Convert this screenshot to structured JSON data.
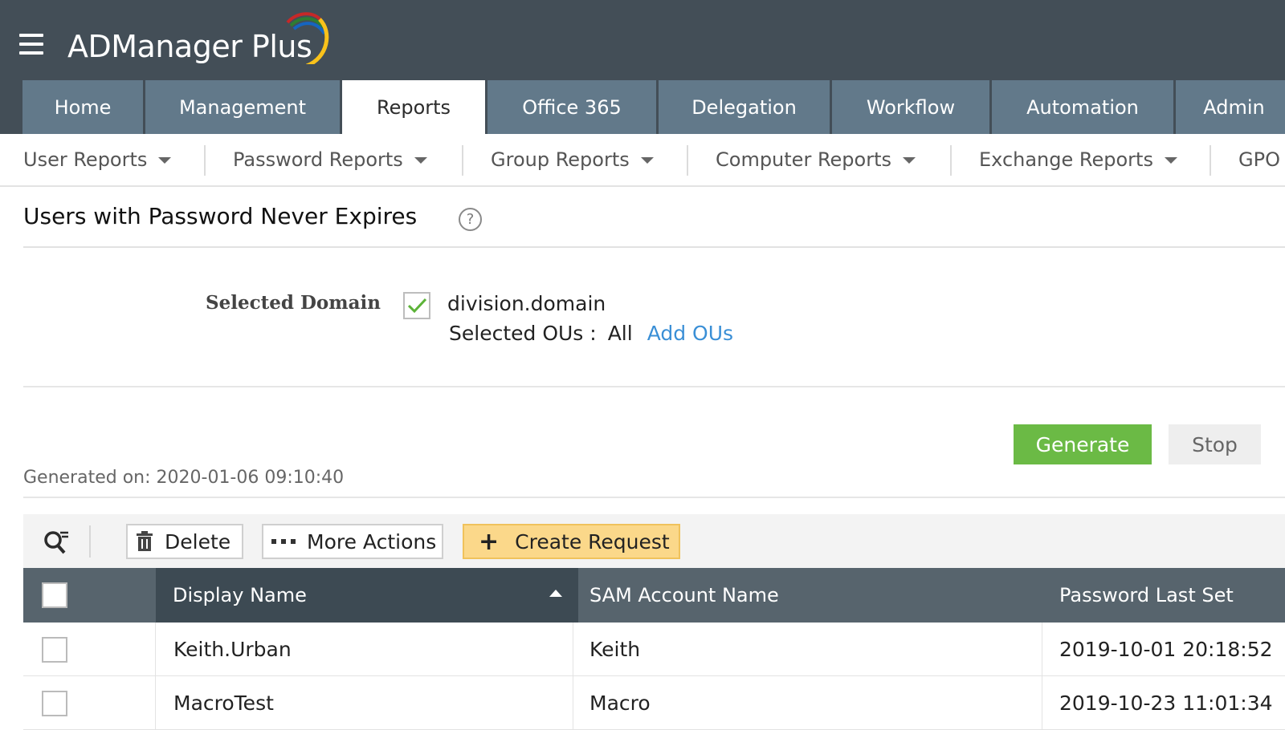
{
  "header": {
    "app_name": "ADManager Plus",
    "icons": {
      "menu": "hamburger-icon",
      "logo": "swoosh-logo"
    }
  },
  "main_nav": {
    "tabs": [
      {
        "label": "Home",
        "active": false
      },
      {
        "label": "Management",
        "active": false
      },
      {
        "label": "Reports",
        "active": true
      },
      {
        "label": "Office 365",
        "active": false
      },
      {
        "label": "Delegation",
        "active": false
      },
      {
        "label": "Workflow",
        "active": false
      },
      {
        "label": "Automation",
        "active": false
      },
      {
        "label": "Admin",
        "active": false
      }
    ]
  },
  "sub_nav": {
    "items": [
      {
        "label": "User Reports"
      },
      {
        "label": "Password Reports"
      },
      {
        "label": "Group Reports"
      },
      {
        "label": "Computer Reports"
      },
      {
        "label": "Exchange Reports"
      },
      {
        "label": "GPO"
      }
    ]
  },
  "page": {
    "title": "Users with Password Never Expires",
    "help_icon": "?"
  },
  "domain": {
    "label": "Selected Domain",
    "name": "division.domain",
    "checked": true,
    "ous_label": "Selected OUs :",
    "ous_value": "All",
    "add_ous_link": "Add OUs"
  },
  "actions": {
    "generate_label": "Generate",
    "stop_label": "Stop"
  },
  "generated_on": "Generated on: 2020-01-06 09:10:40",
  "toolbar": {
    "delete_label": "Delete",
    "more_actions_label": "More Actions",
    "create_request_label": "Create Request",
    "plus_symbol": "+"
  },
  "table": {
    "columns": [
      "Display Name",
      "SAM Account Name",
      "Password Last Set"
    ],
    "sorted_column": "Display Name",
    "sort_direction": "ascending",
    "rows": [
      {
        "display_name": "Keith.Urban",
        "sam_account_name": "Keith",
        "password_last_set": "2019-10-01 20:18:52"
      },
      {
        "display_name": "MacroTest",
        "sam_account_name": "Macro",
        "password_last_set": "2019-10-23 11:01:34"
      }
    ]
  },
  "colors": {
    "header_bg": "#434e57",
    "tab_bg": "#62798a",
    "generate_green": "#6bba45",
    "create_request_yellow": "#fbd88a",
    "link_blue": "#3a8fd6",
    "table_header_bg": "#57646d",
    "sorted_header_bg": "#3d4a53"
  }
}
